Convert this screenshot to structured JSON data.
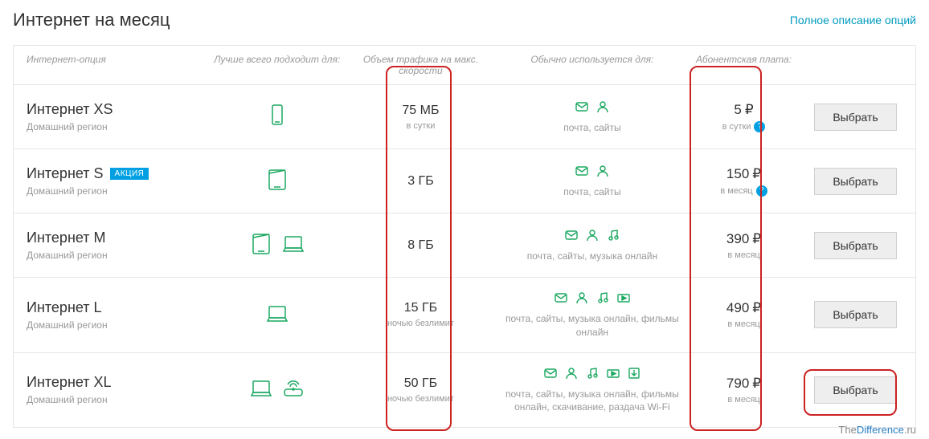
{
  "header": {
    "title": "Интернет на месяц",
    "full_description": "Полное описание опций"
  },
  "columns": {
    "name": "Интернет-опция",
    "device": "Лучше всего подходит для:",
    "traffic": "Объем трафика на макс. скорости",
    "usage": "Обычно используется для:",
    "price": "Абонентская плата:"
  },
  "plans": [
    {
      "title": "Интернет XS",
      "subtitle": "Домашний регион",
      "badge": "",
      "devices": [
        "phone"
      ],
      "traffic": "75 МБ",
      "traffic_sub": "в сутки",
      "usage_icons": [
        "mail",
        "person"
      ],
      "usage_text": "почта, сайты",
      "price": "5",
      "price_sub": "в сутки",
      "info": true,
      "action": "Выбрать"
    },
    {
      "title": "Интернет S",
      "subtitle": "Домашний регион",
      "badge": "АКЦИЯ",
      "devices": [
        "tablet"
      ],
      "traffic": "3 ГБ",
      "traffic_sub": "",
      "usage_icons": [
        "mail",
        "person"
      ],
      "usage_text": "почта, сайты",
      "price": "150",
      "price_sub": "в месяц",
      "info": true,
      "action": "Выбрать"
    },
    {
      "title": "Интернет M",
      "subtitle": "Домашний регион",
      "badge": "",
      "devices": [
        "tablet",
        "laptop"
      ],
      "traffic": "8 ГБ",
      "traffic_sub": "",
      "usage_icons": [
        "mail",
        "person",
        "music"
      ],
      "usage_text": "почта, сайты, музыка онлайн",
      "price": "390",
      "price_sub": "в месяц",
      "info": false,
      "action": "Выбрать"
    },
    {
      "title": "Интернет L",
      "subtitle": "Домашний регион",
      "badge": "",
      "devices": [
        "laptop"
      ],
      "traffic": "15 ГБ",
      "traffic_sub": "ночью безлимит",
      "usage_icons": [
        "mail",
        "person",
        "music",
        "video"
      ],
      "usage_text": "почта, сайты, музыка онлайн, фильмы онлайн",
      "price": "490",
      "price_sub": "в месяц",
      "info": false,
      "action": "Выбрать"
    },
    {
      "title": "Интернет XL",
      "subtitle": "Домашний регион",
      "badge": "",
      "devices": [
        "laptop",
        "router"
      ],
      "traffic": "50 ГБ",
      "traffic_sub": "ночью безлимит",
      "usage_icons": [
        "mail",
        "person",
        "music",
        "video",
        "download"
      ],
      "usage_text": "почта, сайты, музыка онлайн, фильмы онлайн, скачивание, раздача Wi-Fi",
      "price": "790",
      "price_sub": "в месяц",
      "info": false,
      "action": "Выбрать"
    }
  ],
  "watermark": {
    "a": "The",
    "b": "Difference",
    "c": ".ru"
  }
}
